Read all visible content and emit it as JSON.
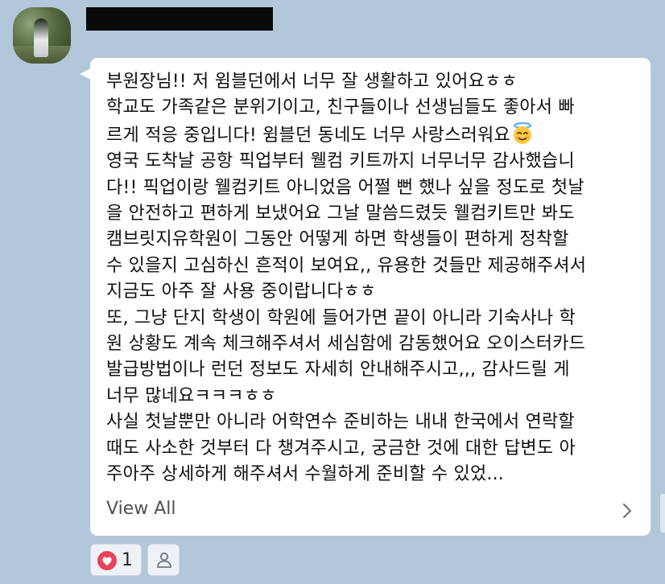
{
  "chat": {
    "sender": {
      "avatar_alt": "profile-photo",
      "name_redacted": true
    },
    "message": {
      "lines": [
        "부원장님!! 저 윔블던에서 너무 잘 생활하고 있어요ㅎㅎ",
        "학교도 가족같은 분위기이고, 친구들이나 선생님들도 좋아서 빠",
        "르게 적응 중입니다! 윔블던 동네도 너무 사랑스러워요",
        "영국 도착날 공항 픽업부터 웰컴 키트까지 너무너무 감사했습니",
        "다!! 픽업이랑 웰컴키트 아니었음 어쩔 뻔 했나 싶을 정도로 첫날",
        "을 안전하고 편하게 보냈어요 그날 말씀드렸듯 웰컴키트만 봐도",
        "캠브릿지유학원이 그동안 어떻게 하면 학생들이 편하게 정착할",
        "수 있을지 고심하신 흔적이 보여요,, 유용한 것들만 제공해주셔서",
        "지금도 아주 잘 사용 중이랍니다ㅎㅎ",
        "또, 그냥 단지 학생이 학원에 들어가면 끝이 아니라 기숙사나 학",
        "원 상황도 계속 체크해주셔서 세심함에 감동했어요 오이스터카드",
        "발급방법이나 런던 정보도 자세히 안내해주시고,,, 감사드릴 게",
        "너무 많네요ㅋㅋㅋㅎㅎ",
        "사실 첫날뿐만 아니라 어학연수 준비하는 내내 한국에서 연락할",
        "때도 사소한 것부터 다 챙겨주시고, 궁금한 것에 대한 답변도 아",
        "주아주 상세하게 해주셔서 수월하게 준비할 수 있었..."
      ],
      "inline_emoji": "smiling-face-with-halo",
      "view_all_label": "View All"
    },
    "reactions": {
      "like_count": "1",
      "like_icon": "heart-icon",
      "member_icon": "person-icon"
    }
  },
  "colors": {
    "background": "#b2c7d9",
    "bubble": "#ffffff",
    "text": "#111111",
    "heart": "#e8435a"
  }
}
